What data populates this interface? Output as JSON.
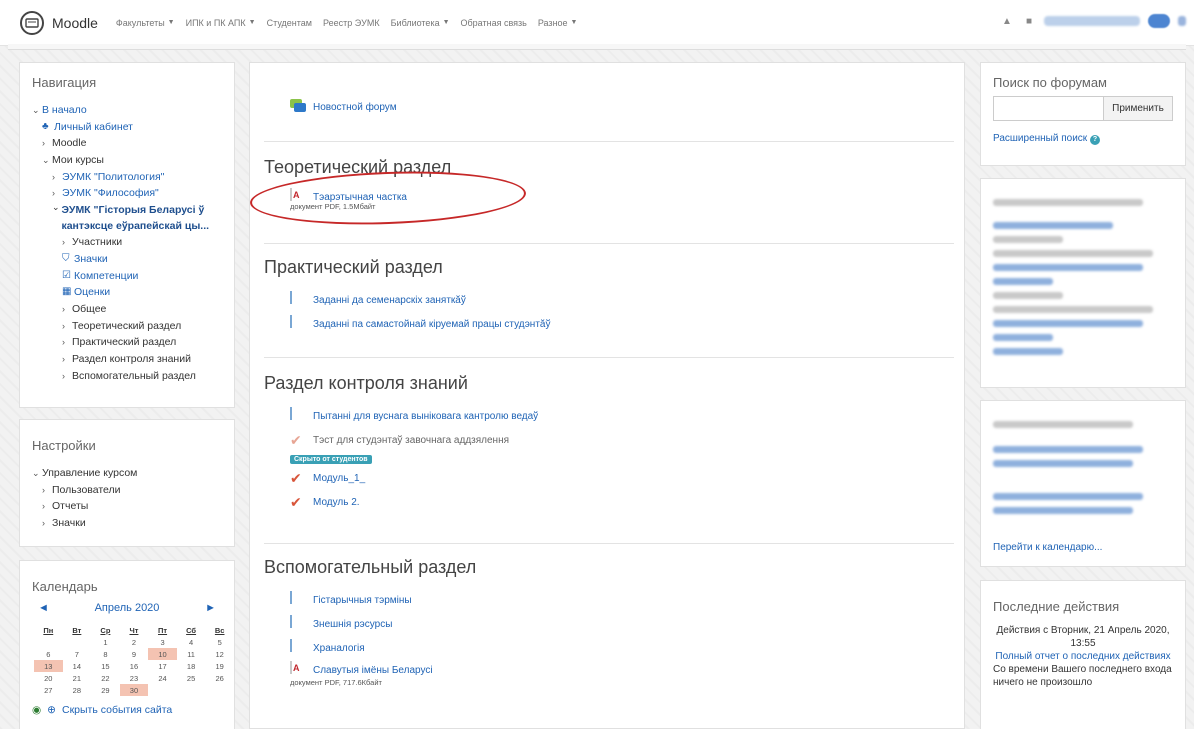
{
  "header": {
    "brand": "Moodle",
    "menu": [
      {
        "label": "Факультеты",
        "dropdown": true
      },
      {
        "label": "ИПК и ПК АПК",
        "dropdown": true
      },
      {
        "label": "Студентам",
        "dropdown": false
      },
      {
        "label": "Реестр ЭУМК",
        "dropdown": false
      },
      {
        "label": "Библиотека",
        "dropdown": true
      },
      {
        "label": "Обратная связь",
        "dropdown": false
      },
      {
        "label": "Разное",
        "dropdown": true
      }
    ]
  },
  "navigation": {
    "title": "Навигация",
    "home": "В начало",
    "dashboard": "Личный кабинет",
    "moodle": "Moodle",
    "my_courses": "Мои курсы",
    "course1": "ЭУМК \"Политология\"",
    "course2": "ЭУМК \"Философия\"",
    "course3": "ЭУМК \"Гісторыя Беларусі ў кантэксце еўрапейскай цы...",
    "participants": "Участники",
    "badges": "Значки",
    "competencies": "Компетенции",
    "grades": "Оценки",
    "general": "Общее",
    "theory": "Теоретический раздел",
    "practice": "Практический раздел",
    "control": "Раздел контроля знаний",
    "auxiliary": "Вспомогательный раздел"
  },
  "settings": {
    "title": "Настройки",
    "course_admin": "Управление курсом",
    "users": "Пользователи",
    "reports": "Отчеты",
    "badges": "Значки"
  },
  "calendar": {
    "title": "Календарь",
    "month": "Апрель 2020",
    "prev": "◄",
    "next": "►",
    "weekdays": [
      "Пн",
      "Вт",
      "Ср",
      "Чт",
      "Пт",
      "Сб",
      "Вс"
    ],
    "weeks": [
      [
        "",
        "",
        "1",
        "2",
        "3",
        "4",
        "5"
      ],
      [
        "6",
        "7",
        "8",
        "9",
        "10",
        "11",
        "12"
      ],
      [
        "13",
        "14",
        "15",
        "16",
        "17",
        "18",
        "19"
      ],
      [
        "20",
        "21",
        "22",
        "23",
        "24",
        "25",
        "26"
      ],
      [
        "27",
        "28",
        "29",
        "30",
        "",
        "",
        ""
      ]
    ],
    "highlighted": [
      "10",
      "13",
      "30"
    ],
    "footer_link": "Скрыть события сайта"
  },
  "main": {
    "news_forum": "Новостной форум",
    "sections": {
      "theory": {
        "title": "Теоретический раздел",
        "items": [
          {
            "label": "Тэарэтычная частка",
            "meta": "документ PDF, 1.5Мбайт"
          }
        ]
      },
      "practice": {
        "title": "Практический раздел",
        "items": [
          {
            "label": "Заданні да семенарскіх заняткӑў"
          },
          {
            "label": "Заданні па самастойнай кіруемай працы студэнтӑў"
          }
        ]
      },
      "control": {
        "title": "Раздел контроля знаний",
        "items": [
          {
            "label": "Пытанні для вуснага выніковага кантролю ведаў"
          },
          {
            "label": "Тэст для студэнтаў завочнага аддзялення"
          },
          {
            "label": "Модуль_1_"
          },
          {
            "label": "Модуль 2."
          }
        ],
        "hidden_badge": "Скрыто от студентов"
      },
      "auxiliary": {
        "title": "Вспомогательный раздел",
        "items": [
          {
            "label": "Гістарычныя тэрміны"
          },
          {
            "label": "Знешнія рэсурсы"
          },
          {
            "label": "Храналогія"
          },
          {
            "label": "Славутыя імёны Беларусі",
            "meta": "документ PDF, 717.6Кбайт"
          }
        ]
      }
    }
  },
  "right": {
    "forum_search": {
      "title": "Поиск по форумам",
      "button": "Применить",
      "advanced": "Расширенный поиск"
    },
    "calendar_link": "Перейти к календарю...",
    "recent": {
      "title": "Последние действия",
      "since": "Действия с Вторник, 21 Апрель 2020, 13:55",
      "full_report": "Полный отчет о последних действиях",
      "nothing": "Со времени Вашего последнего входа ничего не произошло"
    }
  }
}
